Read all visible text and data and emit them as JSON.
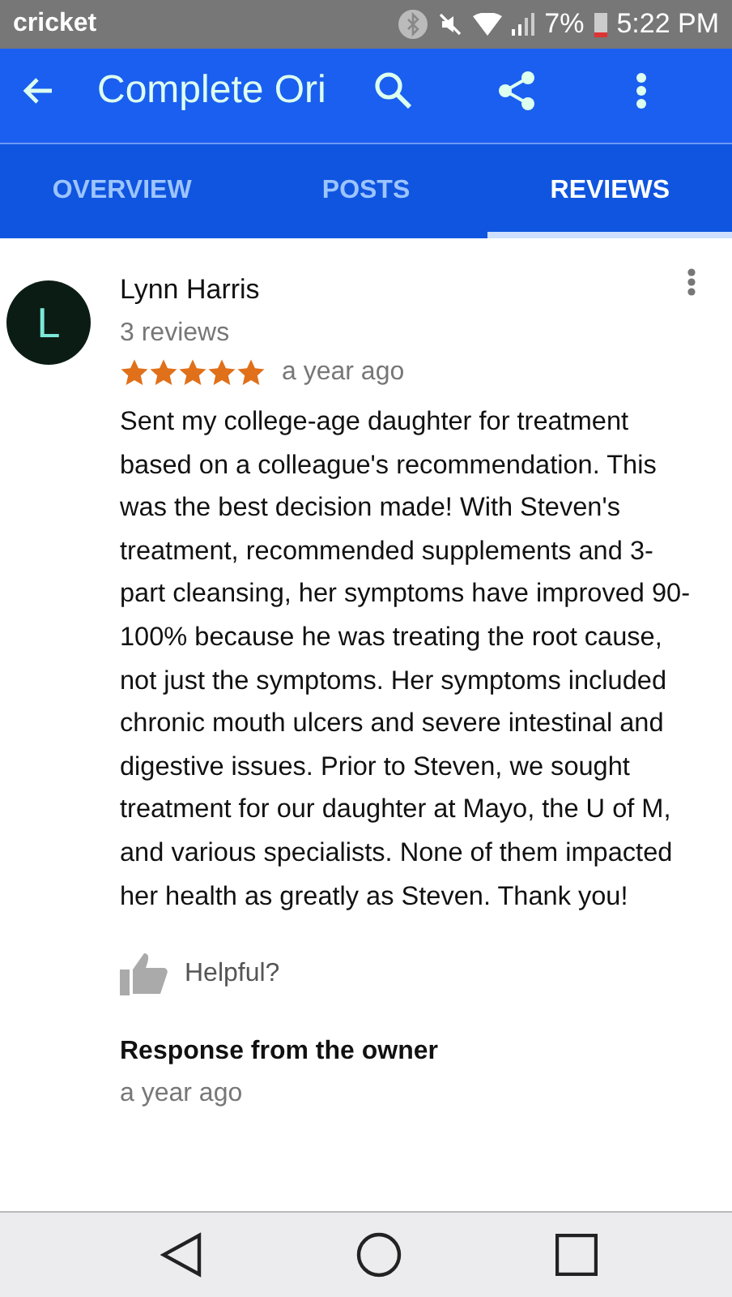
{
  "status_bar": {
    "carrier": "cricket",
    "battery": "7%",
    "time": "5:22 PM"
  },
  "app_bar": {
    "title": "Complete Ori"
  },
  "tabs": [
    {
      "label": "OVERVIEW",
      "selected": false
    },
    {
      "label": "POSTS",
      "selected": false
    },
    {
      "label": "REVIEWS",
      "selected": true
    }
  ],
  "review": {
    "avatar_letter": "L",
    "author": "Lynn Harris",
    "review_count": "3 reviews",
    "stars": 5,
    "time": "a year ago",
    "text": "Sent my college-age daughter for treatment based on a colleague's recommendation. This was the best decision made!  With Steven's treatment, recommended supplements and 3-part cleansing, her symptoms have improved 90-100% because he was treating the root cause, not just the symptoms.  Her symptoms included chronic mouth ulcers and severe intestinal and digestive issues.  Prior to Steven, we sought treatment for our daughter at Mayo, the U of M, and various specialists.  None of them impacted her health as greatly as Steven.  Thank you!",
    "helpful": "Helpful?",
    "response_title": "Response from the owner",
    "response_time": "a year ago"
  }
}
